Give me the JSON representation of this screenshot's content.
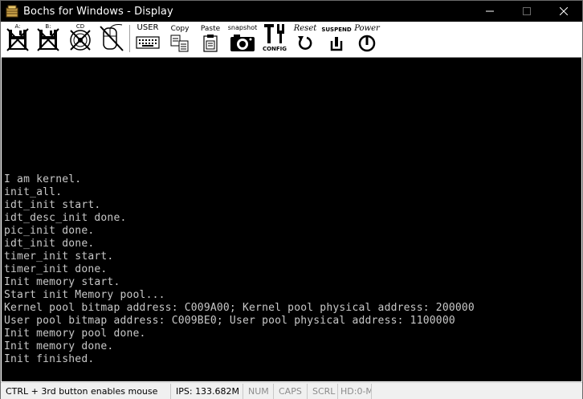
{
  "window": {
    "title": "Bochs for Windows - Display",
    "controls": {
      "minimize": "—",
      "maximize": "☐",
      "close": "✕"
    }
  },
  "toolbar": {
    "floppy_a": {
      "label": "A:",
      "icon": "floppy-a-icon"
    },
    "floppy_b": {
      "label": "B:",
      "icon": "floppy-b-icon"
    },
    "cdrom": {
      "label": "CD",
      "icon": "cdrom-icon"
    },
    "mouse": {
      "label": "",
      "icon": "mouse-icon"
    },
    "user": {
      "label": "USER",
      "icon": "keyboard-icon"
    },
    "copy": {
      "label": "Copy",
      "icon": "copy-icon"
    },
    "paste": {
      "label": "Paste",
      "icon": "paste-icon"
    },
    "snapshot": {
      "label": "snapshot",
      "icon": "camera-icon"
    },
    "config": {
      "label": "CONFIG",
      "icon": "config-icon"
    },
    "reset": {
      "label": "Reset",
      "icon": "reset-icon"
    },
    "suspend": {
      "label": "SUSPEND",
      "icon": "suspend-icon"
    },
    "power": {
      "label": "Power",
      "icon": "power-icon"
    }
  },
  "console": {
    "text_color": "#c8c8c8",
    "lines": [
      "I am kernel.",
      "init_all.",
      "idt_init start.",
      "idt_desc_init done.",
      "pic_init done.",
      "idt_init done.",
      "timer_init start.",
      "timer_init done.",
      "Init memory start.",
      "Start init Memory pool...",
      "Kernel pool bitmap address: C009A00; Kernel pool physical address: 200000",
      "User pool bitmap address: C009BE0; User pool physical address: 1100000",
      "Init memory pool done.",
      "Init memory done.",
      "Init finished."
    ]
  },
  "statusbar": {
    "mouse_hint": "CTRL + 3rd button enables mouse",
    "ips": "IPS: 133.682M",
    "num": "NUM",
    "caps": "CAPS",
    "scrl": "SCRL",
    "hd": "HD:0-M"
  }
}
